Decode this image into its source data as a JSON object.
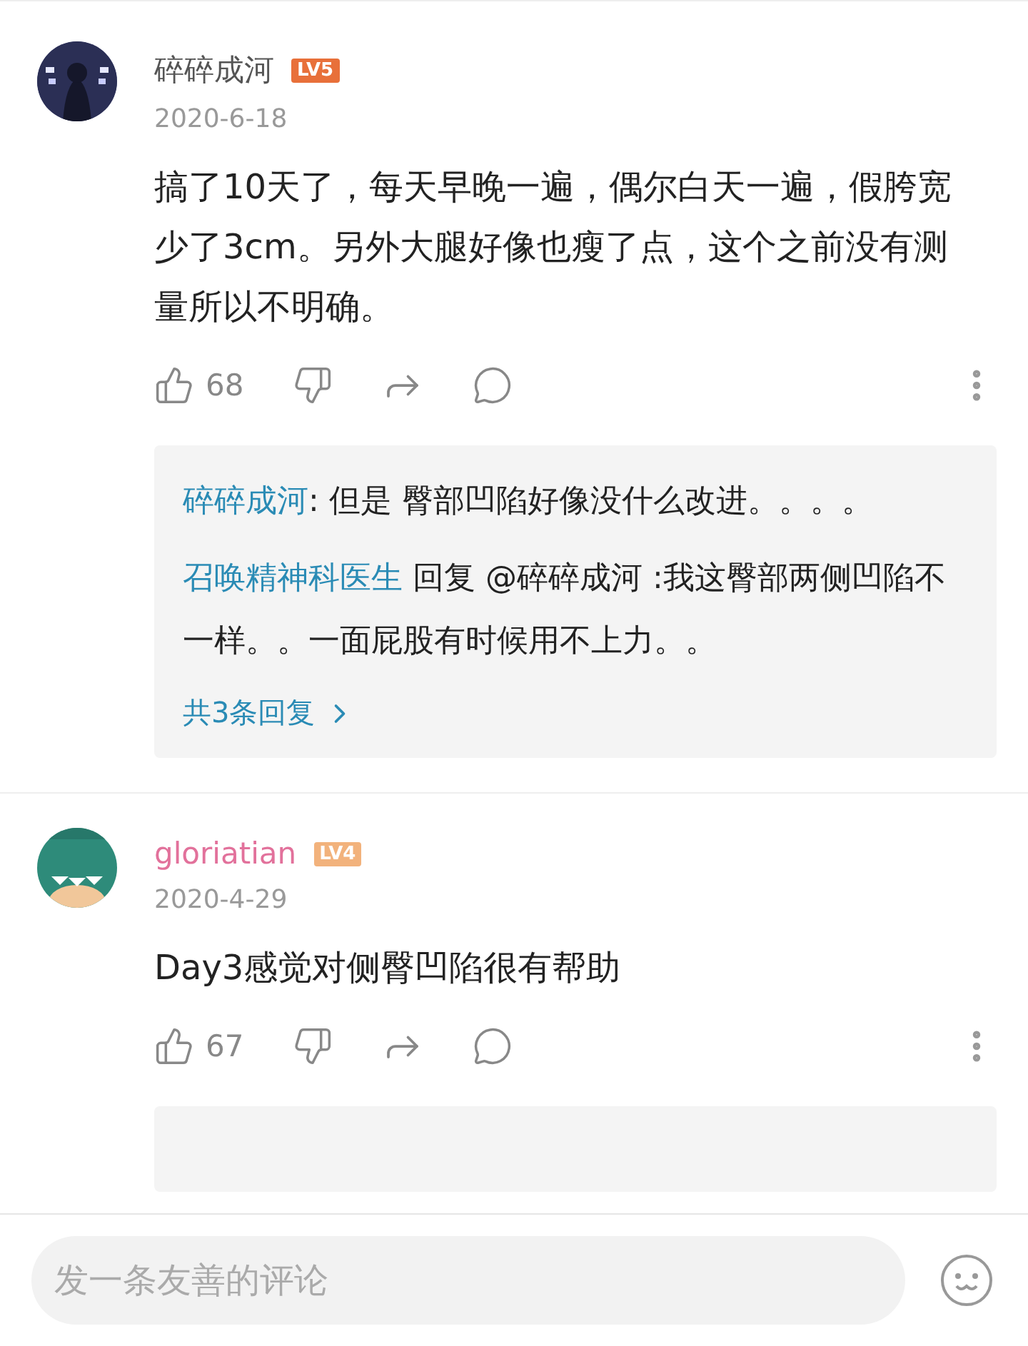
{
  "comments": [
    {
      "author": "碎碎成河",
      "color": "#555555",
      "badge": {
        "text": "LV5",
        "color": "#e8703a"
      },
      "date": "2020-6-18",
      "content": "搞了10天了，每天早晚一遍，偶尔白天一遍，假胯宽少了3cm。另外大腿好像也瘦了点，这个之前没有测量所以不明确。",
      "likes": "68",
      "replies": [
        {
          "author": "碎碎成河",
          "text": ": 但是  臀部凹陷好像没什么改进。。。。"
        },
        {
          "author": "召唤精神科医生",
          "text": " 回复 @碎碎成河 :我这臀部两侧凹陷不一样。。一面屁股有时候用不上力。。"
        }
      ],
      "more_replies": "共3条回复"
    },
    {
      "author": "gloriatian",
      "color": "#e2719b",
      "badge": {
        "text": "LV4",
        "color": "#f2b27c"
      },
      "date": "2020-4-29",
      "content": "Day3感觉对侧臀凹陷很有帮助",
      "likes": "67"
    }
  ],
  "comment_input": {
    "placeholder": "发一条友善的评论"
  }
}
